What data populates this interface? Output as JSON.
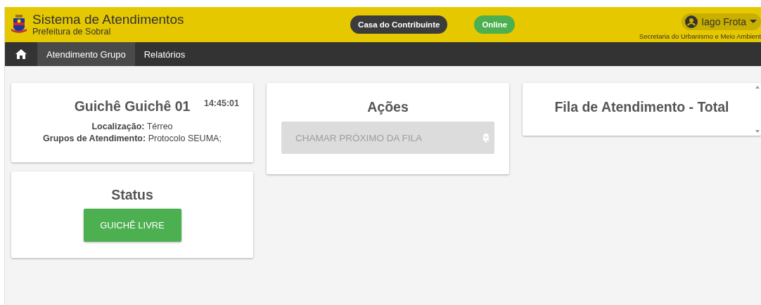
{
  "header": {
    "title": "Sistema de Atendimentos",
    "subtitle": "Prefeitura de Sobral",
    "service_button": "Casa do Contribuinte",
    "connection_badge": "Online",
    "user": {
      "name": "Iago Frota",
      "department": "Secretaria do Urbanismo e Meio Ambient"
    }
  },
  "nav": {
    "tabs": [
      {
        "label": "Atendimento Grupo",
        "selected": true
      },
      {
        "label": "Relatórios",
        "selected": false
      }
    ]
  },
  "counter_card": {
    "title": "Guichê Guichê 01",
    "time": "14:45:01",
    "details": [
      {
        "label": "Localização:",
        "value": "Térreo"
      },
      {
        "label": "Grupos de Atendimento:",
        "value": "Protocolo SEUMA;"
      }
    ]
  },
  "status_card": {
    "title": "Status",
    "button": "GUICHÊ LIVRE"
  },
  "actions_card": {
    "title": "Ações",
    "button": {
      "label": "CHAMAR PRÓXIMO DA FILA",
      "disabled": true
    }
  },
  "queue_card": {
    "title": "Fila de Atendimento - Total"
  }
}
